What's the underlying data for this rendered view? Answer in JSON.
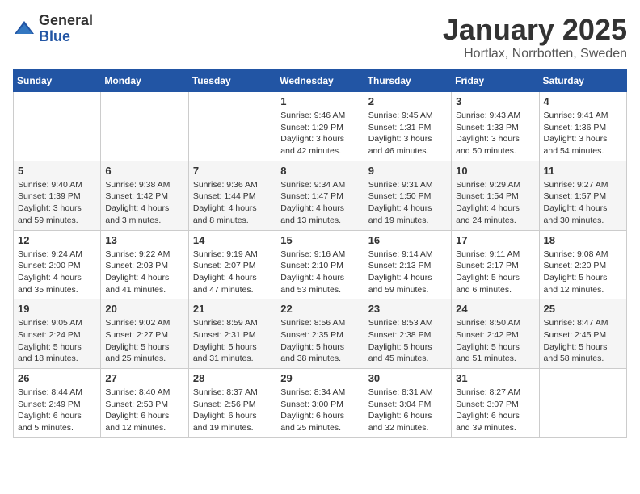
{
  "logo": {
    "general": "General",
    "blue": "Blue"
  },
  "title": "January 2025",
  "subtitle": "Hortlax, Norrbotten, Sweden",
  "headers": [
    "Sunday",
    "Monday",
    "Tuesday",
    "Wednesday",
    "Thursday",
    "Friday",
    "Saturday"
  ],
  "weeks": [
    [
      {
        "day": "",
        "info": ""
      },
      {
        "day": "",
        "info": ""
      },
      {
        "day": "",
        "info": ""
      },
      {
        "day": "1",
        "info": "Sunrise: 9:46 AM\nSunset: 1:29 PM\nDaylight: 3 hours\nand 42 minutes."
      },
      {
        "day": "2",
        "info": "Sunrise: 9:45 AM\nSunset: 1:31 PM\nDaylight: 3 hours\nand 46 minutes."
      },
      {
        "day": "3",
        "info": "Sunrise: 9:43 AM\nSunset: 1:33 PM\nDaylight: 3 hours\nand 50 minutes."
      },
      {
        "day": "4",
        "info": "Sunrise: 9:41 AM\nSunset: 1:36 PM\nDaylight: 3 hours\nand 54 minutes."
      }
    ],
    [
      {
        "day": "5",
        "info": "Sunrise: 9:40 AM\nSunset: 1:39 PM\nDaylight: 3 hours\nand 59 minutes."
      },
      {
        "day": "6",
        "info": "Sunrise: 9:38 AM\nSunset: 1:42 PM\nDaylight: 4 hours\nand 3 minutes."
      },
      {
        "day": "7",
        "info": "Sunrise: 9:36 AM\nSunset: 1:44 PM\nDaylight: 4 hours\nand 8 minutes."
      },
      {
        "day": "8",
        "info": "Sunrise: 9:34 AM\nSunset: 1:47 PM\nDaylight: 4 hours\nand 13 minutes."
      },
      {
        "day": "9",
        "info": "Sunrise: 9:31 AM\nSunset: 1:50 PM\nDaylight: 4 hours\nand 19 minutes."
      },
      {
        "day": "10",
        "info": "Sunrise: 9:29 AM\nSunset: 1:54 PM\nDaylight: 4 hours\nand 24 minutes."
      },
      {
        "day": "11",
        "info": "Sunrise: 9:27 AM\nSunset: 1:57 PM\nDaylight: 4 hours\nand 30 minutes."
      }
    ],
    [
      {
        "day": "12",
        "info": "Sunrise: 9:24 AM\nSunset: 2:00 PM\nDaylight: 4 hours\nand 35 minutes."
      },
      {
        "day": "13",
        "info": "Sunrise: 9:22 AM\nSunset: 2:03 PM\nDaylight: 4 hours\nand 41 minutes."
      },
      {
        "day": "14",
        "info": "Sunrise: 9:19 AM\nSunset: 2:07 PM\nDaylight: 4 hours\nand 47 minutes."
      },
      {
        "day": "15",
        "info": "Sunrise: 9:16 AM\nSunset: 2:10 PM\nDaylight: 4 hours\nand 53 minutes."
      },
      {
        "day": "16",
        "info": "Sunrise: 9:14 AM\nSunset: 2:13 PM\nDaylight: 4 hours\nand 59 minutes."
      },
      {
        "day": "17",
        "info": "Sunrise: 9:11 AM\nSunset: 2:17 PM\nDaylight: 5 hours\nand 6 minutes."
      },
      {
        "day": "18",
        "info": "Sunrise: 9:08 AM\nSunset: 2:20 PM\nDaylight: 5 hours\nand 12 minutes."
      }
    ],
    [
      {
        "day": "19",
        "info": "Sunrise: 9:05 AM\nSunset: 2:24 PM\nDaylight: 5 hours\nand 18 minutes."
      },
      {
        "day": "20",
        "info": "Sunrise: 9:02 AM\nSunset: 2:27 PM\nDaylight: 5 hours\nand 25 minutes."
      },
      {
        "day": "21",
        "info": "Sunrise: 8:59 AM\nSunset: 2:31 PM\nDaylight: 5 hours\nand 31 minutes."
      },
      {
        "day": "22",
        "info": "Sunrise: 8:56 AM\nSunset: 2:35 PM\nDaylight: 5 hours\nand 38 minutes."
      },
      {
        "day": "23",
        "info": "Sunrise: 8:53 AM\nSunset: 2:38 PM\nDaylight: 5 hours\nand 45 minutes."
      },
      {
        "day": "24",
        "info": "Sunrise: 8:50 AM\nSunset: 2:42 PM\nDaylight: 5 hours\nand 51 minutes."
      },
      {
        "day": "25",
        "info": "Sunrise: 8:47 AM\nSunset: 2:45 PM\nDaylight: 5 hours\nand 58 minutes."
      }
    ],
    [
      {
        "day": "26",
        "info": "Sunrise: 8:44 AM\nSunset: 2:49 PM\nDaylight: 6 hours\nand 5 minutes."
      },
      {
        "day": "27",
        "info": "Sunrise: 8:40 AM\nSunset: 2:53 PM\nDaylight: 6 hours\nand 12 minutes."
      },
      {
        "day": "28",
        "info": "Sunrise: 8:37 AM\nSunset: 2:56 PM\nDaylight: 6 hours\nand 19 minutes."
      },
      {
        "day": "29",
        "info": "Sunrise: 8:34 AM\nSunset: 3:00 PM\nDaylight: 6 hours\nand 25 minutes."
      },
      {
        "day": "30",
        "info": "Sunrise: 8:31 AM\nSunset: 3:04 PM\nDaylight: 6 hours\nand 32 minutes."
      },
      {
        "day": "31",
        "info": "Sunrise: 8:27 AM\nSunset: 3:07 PM\nDaylight: 6 hours\nand 39 minutes."
      },
      {
        "day": "",
        "info": ""
      }
    ]
  ]
}
